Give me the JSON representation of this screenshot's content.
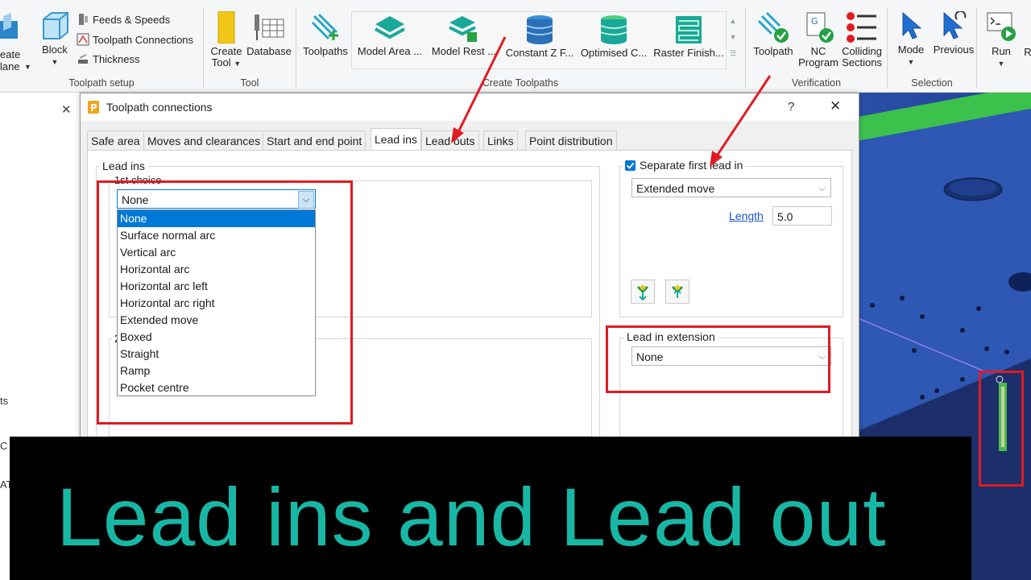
{
  "ribbon": {
    "setup": {
      "label": "Toolpath setup",
      "create_plane": "eate\nlane",
      "block": "Block",
      "feeds": "Feeds & Speeds",
      "connections": "Toolpath Connections",
      "thickness": "Thickness"
    },
    "tool": {
      "label": "Tool",
      "create_tool_l1": "Create",
      "create_tool_l2": "Tool",
      "database": "Database"
    },
    "create": {
      "label": "Create Toolpaths",
      "toolpaths": "Toolpaths",
      "model_area": "Model Area ...",
      "model_rest": "Model Rest ...",
      "constant_z": "Constant Z F...",
      "optimised": "Optimised C...",
      "raster": "Raster Finish..."
    },
    "verification": {
      "label": "Verification",
      "toolpath": "Toolpath",
      "nc_l1": "NC",
      "nc_l2": "Program",
      "colliding_l1": "Colliding",
      "colliding_l2": "Sections"
    },
    "selection": {
      "label": "Selection",
      "mode": "Mode",
      "previous": "Previous"
    },
    "run": {
      "run": "Run",
      "r": "R"
    }
  },
  "left_panel": {
    "fragment1": "ts",
    "fragment2": "C",
    "fragment3": "AT"
  },
  "dialog": {
    "title": "Toolpath connections",
    "help": "?",
    "close": "✕",
    "tabs": [
      {
        "label": "Safe area"
      },
      {
        "label": "Moves and clearances"
      },
      {
        "label": "Start and end point"
      },
      {
        "label": "Lead ins"
      },
      {
        "label": "Lead outs"
      },
      {
        "label": "Links"
      },
      {
        "label": "Point distribution"
      }
    ],
    "lead_ins": {
      "legend": "Lead ins",
      "first_choice": "1st choice",
      "second_prefix": "2",
      "value": "None",
      "options": [
        "None",
        "Surface normal arc",
        "Vertical arc",
        "Horizontal arc",
        "Horizontal arc left",
        "Horizontal arc right",
        "Extended move",
        "Boxed",
        "Straight",
        "Ramp",
        "Pocket centre"
      ]
    },
    "separate": {
      "label": "Separate first lead in",
      "checked": true,
      "value": "Extended move",
      "length_label": "Length",
      "length_value": "5.0"
    },
    "extension": {
      "legend": "Lead in extension",
      "value": "None"
    }
  },
  "outside_close": "✕",
  "banner": {
    "text": "Lead ins and Lead out"
  },
  "colors": {
    "annotation_red": "#e01b22",
    "banner_text": "#18b7a5",
    "select_blue": "#0078d7"
  }
}
